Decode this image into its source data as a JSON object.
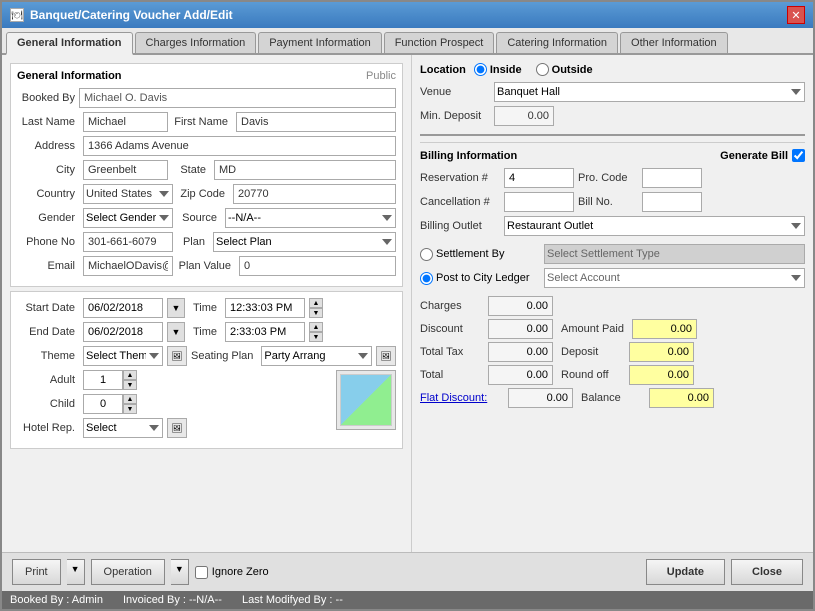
{
  "window": {
    "title": "Banquet/Catering Voucher Add/Edit",
    "icon": "🍽"
  },
  "tabs": [
    {
      "label": "General Information",
      "active": true
    },
    {
      "label": "Charges Information",
      "active": false
    },
    {
      "label": "Payment Information",
      "active": false
    },
    {
      "label": "Function Prospect",
      "active": false
    },
    {
      "label": "Catering Information",
      "active": false
    },
    {
      "label": "Other Information",
      "active": false
    }
  ],
  "general": {
    "section_title": "General Information",
    "public_label": "Public",
    "booked_by_label": "Booked By",
    "booked_by_value": "Michael O. Davis",
    "last_name_label": "Last Name",
    "last_name_value": "Michael",
    "first_name_label": "First Name",
    "first_name_value": "Davis",
    "address_label": "Address",
    "address_value": "1366 Adams Avenue",
    "city_label": "City",
    "city_value": "Greenbelt",
    "state_label": "State",
    "state_value": "MD",
    "country_label": "Country",
    "country_value": "United States",
    "zip_label": "Zip Code",
    "zip_value": "20770",
    "gender_label": "Gender",
    "gender_value": "Select Gender",
    "source_label": "Source",
    "source_value": "--N/A--",
    "phone_label": "Phone No",
    "phone_value": "301-661-6079",
    "plan_label": "Plan",
    "plan_value": "Select Plan",
    "email_label": "Email",
    "email_value": "MichaelODavis@dayr",
    "plan_value_label": "Plan Value",
    "plan_value_value": "0"
  },
  "dates": {
    "start_date_label": "Start Date",
    "start_date_value": "06/02/2018",
    "start_time_label": "Time",
    "start_time_value": "12:33:03 PM",
    "end_date_label": "End Date",
    "end_date_value": "06/02/2018",
    "end_time_label": "Time",
    "end_time_value": "2:33:03 PM",
    "theme_label": "Theme",
    "theme_value": "Select Theme",
    "seating_label": "Seating Plan",
    "seating_value": "Party Arrang",
    "adult_label": "Adult",
    "adult_value": "1",
    "child_label": "Child",
    "child_value": "0",
    "hotel_rep_label": "Hotel Rep.",
    "hotel_rep_value": "Select"
  },
  "location": {
    "section_title": "Location",
    "inside_label": "Inside",
    "outside_label": "Outside",
    "venue_label": "Venue",
    "venue_value": "Banquet Hall",
    "min_deposit_label": "Min. Deposit",
    "min_deposit_value": "0.00"
  },
  "billing": {
    "section_title": "Billing Information",
    "generate_bill_label": "Generate Bill",
    "reservation_label": "Reservation #",
    "reservation_value": "4",
    "pro_code_label": "Pro. Code",
    "pro_code_value": "",
    "cancellation_label": "Cancellation #",
    "cancellation_value": "",
    "bill_no_label": "Bill No.",
    "bill_no_value": "",
    "outlet_label": "Billing Outlet",
    "outlet_value": "Restaurant Outlet"
  },
  "settlement": {
    "by_label": "Settlement By",
    "city_ledger_label": "Post to City Ledger",
    "type_value": "Select Settlement Type",
    "account_value": "Select Account"
  },
  "amounts": {
    "charges_label": "Charges",
    "charges_value": "0.00",
    "discount_label": "Discount",
    "discount_value": "0.00",
    "amount_paid_label": "Amount Paid",
    "amount_paid_value": "0.00",
    "total_tax_label": "Total Tax",
    "total_tax_value": "0.00",
    "deposit_label": "Deposit",
    "deposit_value": "0.00",
    "total_label": "Total",
    "total_value": "0.00",
    "round_off_label": "Round off",
    "round_off_value": "0.00",
    "flat_discount_label": "Flat Discount:",
    "flat_discount_value": "0.00",
    "balance_label": "Balance",
    "balance_value": "0.00"
  },
  "bottom": {
    "print_label": "Print",
    "operation_label": "Operation",
    "ignore_zero_label": "Ignore Zero",
    "update_label": "Update",
    "close_label": "Close"
  },
  "status": {
    "booked_by": "Booked By : Admin",
    "invoiced_by": "Invoiced By : --N/A--",
    "last_modified": "Last Modifyed By : --"
  }
}
